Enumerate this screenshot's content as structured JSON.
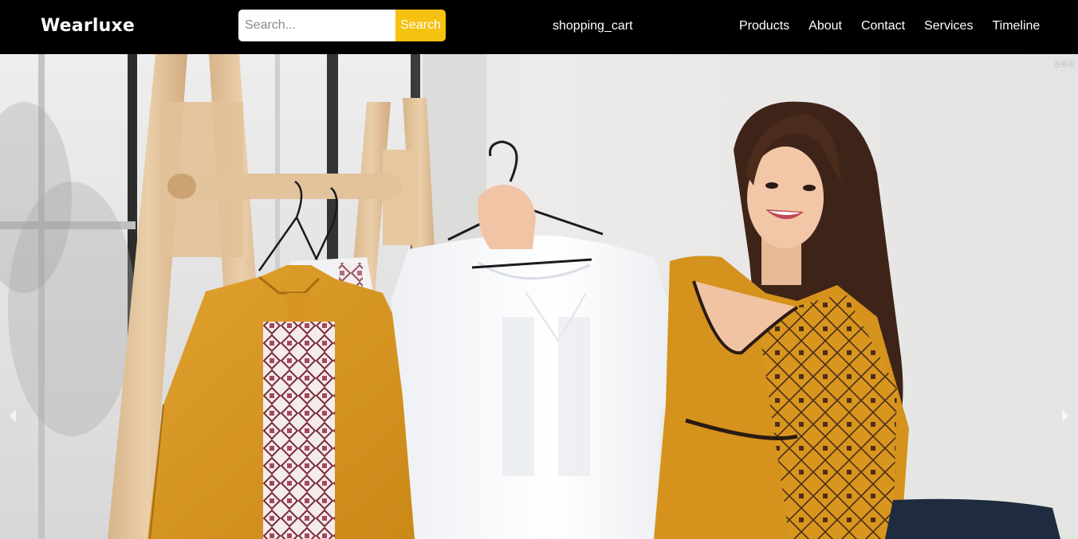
{
  "brand": {
    "name": "Wearluxe"
  },
  "search": {
    "placeholder": "Search...",
    "button_label": "Search"
  },
  "cart": {
    "label": "shopping_cart"
  },
  "nav": {
    "items": [
      "Products",
      "About",
      "Contact",
      "Services",
      "Timeline"
    ]
  },
  "carousel": {
    "counter": "2 of 2",
    "prev_icon": "chevron-left-icon",
    "next_icon": "chevron-right-icon"
  },
  "colors": {
    "nav_bg": "#000000",
    "accent": "#f5c211",
    "text": "#ffffff"
  }
}
